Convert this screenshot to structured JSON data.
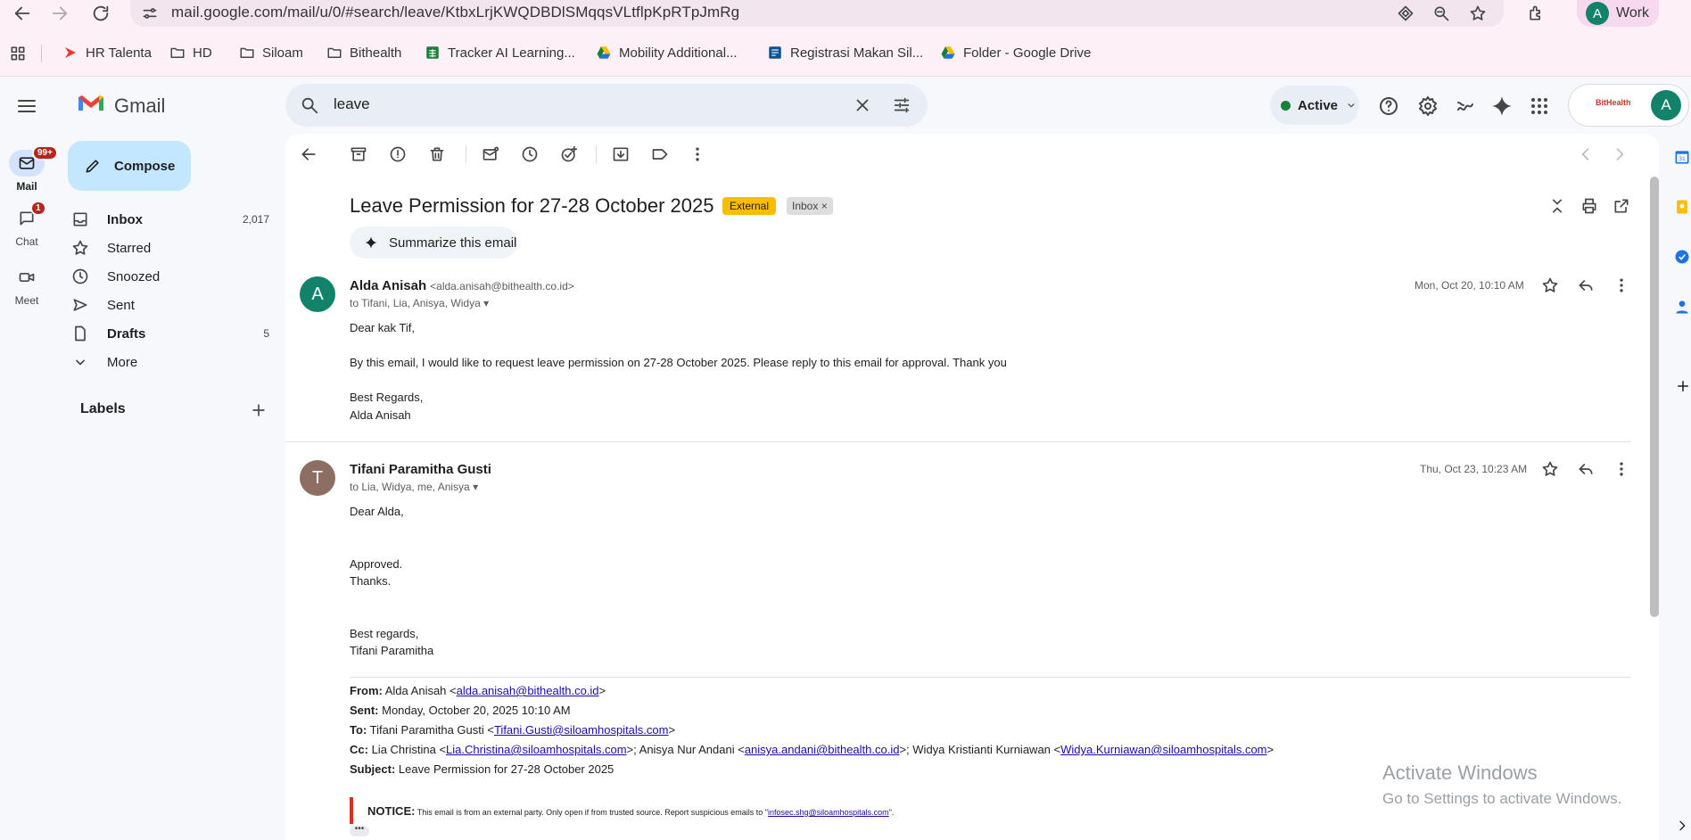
{
  "browser": {
    "url": "mail.google.com/mail/u/0/#search/leave/KtbxLrjKWQDBDlSMqqsVLtflpKpRTpJmRg",
    "profile_initial": "A",
    "profile_name": "Work",
    "bookmarks": [
      {
        "label": "HR Talenta",
        "icon": "red-arrow-icon"
      },
      {
        "label": "HD",
        "icon": "folder-icon"
      },
      {
        "label": "Siloam",
        "icon": "folder-icon"
      },
      {
        "label": "Bithealth",
        "icon": "folder-icon"
      },
      {
        "label": "Tracker AI Learning...",
        "icon": "sheets-icon"
      },
      {
        "label": "Mobility Additional...",
        "icon": "drive-icon"
      },
      {
        "label": "Registrasi Makan Sil...",
        "icon": "forms-icon"
      },
      {
        "label": "Folder - Google Drive",
        "icon": "drive-icon"
      }
    ]
  },
  "gmail": {
    "logo_text": "Gmail",
    "search_value": "leave",
    "status": "Active",
    "account_initial": "A",
    "account_logo_text": "BitHealth",
    "rail": [
      {
        "label": "Mail",
        "badge": "99+"
      },
      {
        "label": "Chat",
        "badge": "1"
      },
      {
        "label": "Meet",
        "badge": ""
      }
    ],
    "compose_label": "Compose",
    "nav": [
      {
        "label": "Inbox",
        "count": "2,017",
        "bold": true,
        "icon": "inbox-icon"
      },
      {
        "label": "Starred",
        "count": "",
        "bold": false,
        "icon": "star-icon"
      },
      {
        "label": "Snoozed",
        "count": "",
        "bold": false,
        "icon": "clock-icon"
      },
      {
        "label": "Sent",
        "count": "",
        "bold": false,
        "icon": "send-icon"
      },
      {
        "label": "Drafts",
        "count": "5",
        "bold": true,
        "icon": "draft-icon"
      },
      {
        "label": "More",
        "count": "",
        "bold": false,
        "icon": "chevron-down-icon"
      }
    ],
    "labels_heading": "Labels"
  },
  "thread": {
    "subject": "Leave Permission for 27-28 October 2025",
    "tags": [
      "External",
      "Inbox"
    ],
    "summarize_label": "Summarize this email",
    "messages": [
      {
        "initial": "A",
        "avatar_color": "#12826a",
        "sender_name": "Alda Anisah",
        "sender_email": "<alda.anisah@bithealth.co.id>",
        "to": "to Tifani, Lia, Anisya, Widya",
        "date": "Mon, Oct 20, 10:10 AM",
        "body": [
          "Dear kak Tif,",
          "By this email, I would like to request leave permission on 27-28 October 2025. Please reply to this email for approval. Thank you",
          "Best Regards,",
          "Alda Anisah"
        ]
      },
      {
        "initial": "T",
        "avatar_color": "#8d6e63",
        "sender_name": "Tifani Paramitha Gusti",
        "sender_email": "",
        "to": "to Lia, Widya, me, Anisya",
        "date": "Thu, Oct 23, 10:23 AM",
        "body": [
          "Dear Alda,",
          "Approved.",
          "Thanks.",
          "Best regards,",
          "Tifani Paramitha"
        ],
        "quoted": {
          "from_label": "From:",
          "from_name": "Alda Anisah <",
          "from_email": "alda.anisah@bithealth.co.id",
          "sent_label": "Sent:",
          "sent_value": "Monday, October 20, 2025 10:10 AM",
          "to_label": "To:",
          "to_name": "Tifani Paramitha Gusti <",
          "to_email": "Tifani.Gusti@siloamhospitals.com",
          "cc_label": "Cc:",
          "cc1_name": "Lia Christina <",
          "cc1_email": "Lia.Christina@siloamhospitals.com",
          "cc2_name": ">; Anisya Nur Andani <",
          "cc2_email": "anisya.andani@bithealth.co.id",
          "cc3_name": ">; Widya Kristianti Kurniawan <",
          "cc3_email": "Widya.Kurniawan@siloamhospitals.com",
          "subject_label": "Subject:",
          "subject_value": "Leave Permission for 27-28 October 2025"
        },
        "notice_label": "NOTICE:",
        "notice_text": "This email is from an external party. Only open if from trusted source. Report suspicious emails to \"",
        "notice_email": "infosec.shg@siloamhospitals.com",
        "notice_end": "\"."
      }
    ]
  },
  "watermark": {
    "title": "Activate Windows",
    "subtitle": "Go to Settings to activate Windows."
  },
  "colors": {
    "compose": "#c2e7ff",
    "external_tag": "#fbbc04",
    "active_dot": "#188038"
  }
}
